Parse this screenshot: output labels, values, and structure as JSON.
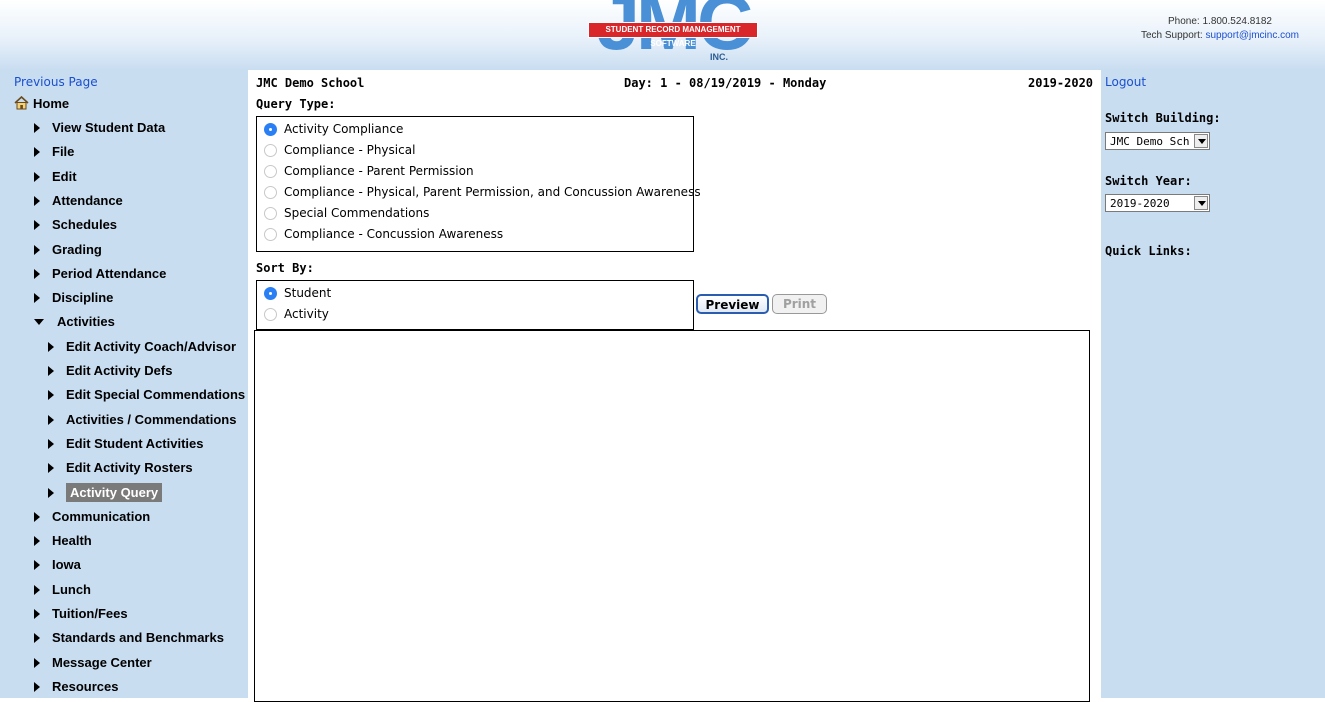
{
  "header": {
    "logo_text": "JMC",
    "logo_banner": "STUDENT RECORD MANAGEMENT SOFTWARE",
    "logo_suffix": "INC.",
    "phone": "Phone: 1.800.524.8182",
    "support_label": "Tech Support:",
    "support_email": "support@jmcinc.com"
  },
  "sidebar": {
    "previous_page": "Previous Page",
    "home": "Home",
    "items": [
      {
        "label": "View Student Data"
      },
      {
        "label": "File"
      },
      {
        "label": "Edit"
      },
      {
        "label": "Attendance"
      },
      {
        "label": "Schedules"
      },
      {
        "label": "Grading"
      },
      {
        "label": "Period Attendance"
      },
      {
        "label": "Discipline"
      },
      {
        "label": "Activities",
        "expanded": true
      },
      {
        "label": "Edit Activity Coach/Advisor",
        "sub": true
      },
      {
        "label": "Edit Activity Defs",
        "sub": true
      },
      {
        "label": "Edit Special Commendations",
        "sub": true
      },
      {
        "label": "Activities / Commendations",
        "sub": true
      },
      {
        "label": "Edit Student Activities",
        "sub": true
      },
      {
        "label": "Edit Activity Rosters",
        "sub": true
      },
      {
        "label": "Activity Query",
        "sub": true,
        "selected": true
      },
      {
        "label": "Communication"
      },
      {
        "label": "Health"
      },
      {
        "label": "Iowa"
      },
      {
        "label": "Lunch"
      },
      {
        "label": "Tuition/Fees"
      },
      {
        "label": "Standards and Benchmarks"
      },
      {
        "label": "Message Center"
      },
      {
        "label": "Resources"
      }
    ]
  },
  "main": {
    "school": "JMC Demo School",
    "day": "Day: 1 - 08/19/2019 - Monday",
    "year": "2019-2020",
    "query_type_label": "Query Type:",
    "query_types": [
      {
        "label": "Activity Compliance",
        "checked": true
      },
      {
        "label": "Compliance - Physical",
        "checked": false
      },
      {
        "label": "Compliance - Parent Permission",
        "checked": false
      },
      {
        "label": "Compliance - Physical, Parent Permission, and Concussion Awareness",
        "checked": false
      },
      {
        "label": "Special Commendations",
        "checked": false
      },
      {
        "label": "Compliance - Concussion Awareness",
        "checked": false
      }
    ],
    "sort_by_label": "Sort By:",
    "sort_by": [
      {
        "label": "Student",
        "checked": true
      },
      {
        "label": "Activity",
        "checked": false
      }
    ],
    "preview_button": "Preview",
    "print_button": "Print"
  },
  "right": {
    "logout": "Logout",
    "switch_building_label": "Switch Building:",
    "building_value": "JMC Demo Sch",
    "switch_year_label": "Switch Year:",
    "year_value": "2019-2020",
    "quick_links_label": "Quick Links:"
  },
  "colors": {
    "sidebar_bg": "#c9ddf1",
    "link": "#1a4fd0",
    "selected_item_bg": "#7a7a7a",
    "radio_checked": "#2a7ff4"
  }
}
